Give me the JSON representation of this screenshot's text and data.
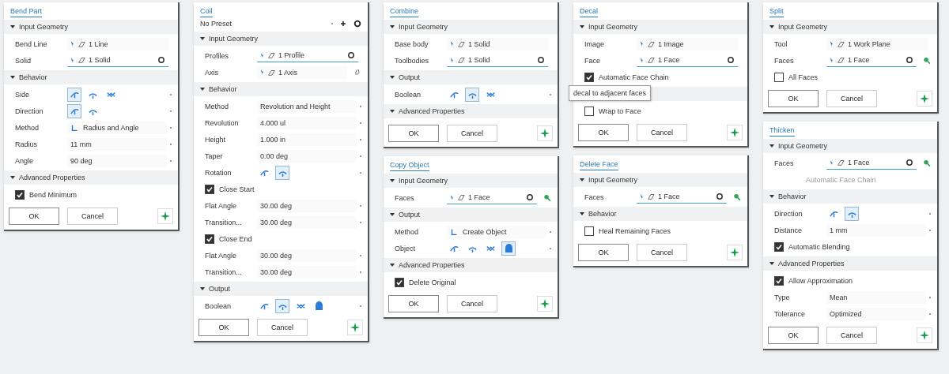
{
  "columns": [
    {
      "panels": [
        {
          "title": "Bend Part",
          "sections": [
            {
              "title": "Input Geometry",
              "rows": [
                {
                  "kind": "select",
                  "label": "Bend Line",
                  "value": "1 Line",
                  "active": false
                },
                {
                  "kind": "select",
                  "label": "Solid",
                  "value": "1 Solid",
                  "active": true
                }
              ]
            },
            {
              "title": "Behavior",
              "rows": [
                {
                  "kind": "icons",
                  "label": "Side",
                  "options": [
                    {
                      "selected": true
                    },
                    {
                      "selected": false
                    },
                    {
                      "selected": false
                    }
                  ]
                },
                {
                  "kind": "icons",
                  "label": "Direction",
                  "options": [
                    {
                      "selected": true
                    },
                    {
                      "selected": false
                    }
                  ]
                },
                {
                  "kind": "dropdown",
                  "label": "Method",
                  "value": "Radius and Angle",
                  "icon": true
                },
                {
                  "kind": "value",
                  "label": "Radius",
                  "value": "11 mm"
                },
                {
                  "kind": "value",
                  "label": "Angle",
                  "value": "90 deg"
                }
              ]
            },
            {
              "title": "Advanced Properties",
              "rows": [
                {
                  "kind": "check",
                  "label": "Bend Minimum",
                  "checked": true
                }
              ]
            }
          ],
          "buttons": [
            "OK",
            "Cancel"
          ]
        }
      ]
    },
    {
      "panels": [
        {
          "title": "Coil",
          "preset": "No Preset",
          "sections": [
            {
              "title": "Input Geometry",
              "rows": [
                {
                  "kind": "select",
                  "label": "Profiles",
                  "value": "1 Profile",
                  "active": true
                },
                {
                  "kind": "select",
                  "label": "Axis",
                  "value": "1 Axis",
                  "active": false,
                  "flip": true
                }
              ]
            },
            {
              "title": "Behavior",
              "rows": [
                {
                  "kind": "dropdown",
                  "label": "Method",
                  "value": "Revolution and Height"
                },
                {
                  "kind": "value",
                  "label": "Revolution",
                  "value": "4.000 ul"
                },
                {
                  "kind": "value",
                  "label": "Height",
                  "value": "1.000 in"
                },
                {
                  "kind": "value",
                  "label": "Taper",
                  "value": "0.00 deg"
                },
                {
                  "kind": "icons",
                  "label": "Rotation",
                  "options": [
                    {
                      "selected": false
                    },
                    {
                      "selected": true
                    }
                  ]
                },
                {
                  "kind": "check",
                  "label": "Close Start",
                  "checked": true
                },
                {
                  "kind": "value",
                  "label": "Flat Angle",
                  "value": "30.00 deg"
                },
                {
                  "kind": "value",
                  "label": "Transition...",
                  "value": "30.00 deg"
                },
                {
                  "kind": "check",
                  "label": "Close End",
                  "checked": true
                },
                {
                  "kind": "value",
                  "label": "Flat Angle",
                  "value": "30.00 deg"
                },
                {
                  "kind": "value",
                  "label": "Transition...",
                  "value": "30.00 deg"
                }
              ]
            },
            {
              "title": "Output",
              "rows": [
                {
                  "kind": "icons",
                  "label": "Boolean",
                  "options": [
                    {
                      "selected": false
                    },
                    {
                      "selected": true
                    },
                    {
                      "selected": false
                    },
                    {
                      "selected": false
                    }
                  ]
                }
              ]
            }
          ],
          "buttons": [
            "OK",
            "Cancel"
          ]
        }
      ]
    },
    {
      "panels": [
        {
          "title": "Combine",
          "sections": [
            {
              "title": "Input Geometry",
              "rows": [
                {
                  "kind": "select",
                  "label": "Base body",
                  "value": "1 Solid",
                  "active": false
                },
                {
                  "kind": "select",
                  "label": "Toolbodies",
                  "value": "1 Solid",
                  "active": true
                }
              ]
            },
            {
              "title": "Output",
              "rows": [
                {
                  "kind": "icons",
                  "label": "Boolean",
                  "options": [
                    {
                      "selected": false
                    },
                    {
                      "selected": true
                    },
                    {
                      "selected": false
                    }
                  ]
                }
              ]
            },
            {
              "title": "Advanced Properties"
            }
          ],
          "buttons": [
            "OK",
            "Cancel"
          ]
        },
        {
          "title": "Copy Object",
          "sections": [
            {
              "title": "Input Geometry",
              "rows": [
                {
                  "kind": "select",
                  "label": "Faces",
                  "value": "1 Face",
                  "active": true,
                  "filter": true
                }
              ]
            },
            {
              "title": "Output",
              "rows": [
                {
                  "kind": "dropdown",
                  "label": "Method",
                  "value": "Create Object",
                  "icon": true
                },
                {
                  "kind": "icons",
                  "label": "Object",
                  "options": [
                    {
                      "selected": false
                    },
                    {
                      "selected": false
                    },
                    {
                      "selected": false
                    },
                    {
                      "selected": true
                    }
                  ]
                }
              ]
            },
            {
              "title": "Advanced Properties",
              "rows": [
                {
                  "kind": "check",
                  "label": "Delete Original",
                  "checked": true
                }
              ]
            }
          ],
          "buttons": [
            "OK",
            "Cancel"
          ]
        }
      ]
    },
    {
      "panels": [
        {
          "title": "Decal",
          "sections": [
            {
              "title": "Input Geometry",
              "rows": [
                {
                  "kind": "select",
                  "label": "Image",
                  "value": "1 Image",
                  "active": false
                },
                {
                  "kind": "select",
                  "label": "Face",
                  "value": "1 Face",
                  "active": true
                },
                {
                  "kind": "check",
                  "label": "Automatic Face Chain",
                  "checked": true
                }
              ]
            },
            {
              "tooltip": "decal to adjacent faces",
              "rows": [
                {
                  "kind": "check",
                  "label": "Wrap to Face",
                  "checked": false
                }
              ]
            }
          ],
          "buttons": [
            "OK",
            "Cancel"
          ]
        },
        {
          "title": "Delete Face",
          "sections": [
            {
              "title": "Input Geometry",
              "rows": [
                {
                  "kind": "select",
                  "label": "Faces",
                  "value": "1 Face",
                  "active": true,
                  "filter": true
                }
              ]
            },
            {
              "title": "Behavior",
              "rows": [
                {
                  "kind": "check",
                  "label": "Heal Remaining Faces",
                  "checked": false
                }
              ]
            }
          ],
          "buttons": [
            "OK",
            "Cancel"
          ]
        }
      ]
    },
    {
      "panels": [
        {
          "title": "Split",
          "sections": [
            {
              "title": "Input Geometry",
              "rows": [
                {
                  "kind": "select",
                  "label": "Tool",
                  "value": "1 Work Plane",
                  "active": false
                },
                {
                  "kind": "select",
                  "label": "Faces",
                  "value": "1 Face",
                  "active": true,
                  "filter": true
                },
                {
                  "kind": "check",
                  "label": "All Faces",
                  "checked": false
                }
              ]
            }
          ],
          "buttons": [
            "OK",
            "Cancel"
          ]
        },
        {
          "title": "Thicken",
          "sections": [
            {
              "title": "Input Geometry",
              "rows": [
                {
                  "kind": "select",
                  "label": "Faces",
                  "value": "1 Face",
                  "active": true,
                  "filter": true
                },
                {
                  "kind": "hint",
                  "label": "Automatic Face Chain"
                }
              ]
            },
            {
              "title": "Behavior",
              "rows": [
                {
                  "kind": "icons",
                  "label": "Direction",
                  "options": [
                    {
                      "selected": false
                    },
                    {
                      "selected": true
                    }
                  ]
                },
                {
                  "kind": "value",
                  "label": "Distance",
                  "value": "1 mm"
                },
                {
                  "kind": "check",
                  "label": "Automatic Blending",
                  "checked": true
                }
              ]
            },
            {
              "title": "Advanced Properties",
              "rows": [
                {
                  "kind": "check",
                  "label": "Allow Approximation",
                  "checked": true
                },
                {
                  "kind": "dropdown",
                  "label": "Type",
                  "value": "Mean"
                },
                {
                  "kind": "dropdown",
                  "label": "Tolerance",
                  "value": "Optimized"
                }
              ]
            }
          ],
          "buttons": [
            "OK",
            "Cancel"
          ]
        }
      ]
    }
  ]
}
